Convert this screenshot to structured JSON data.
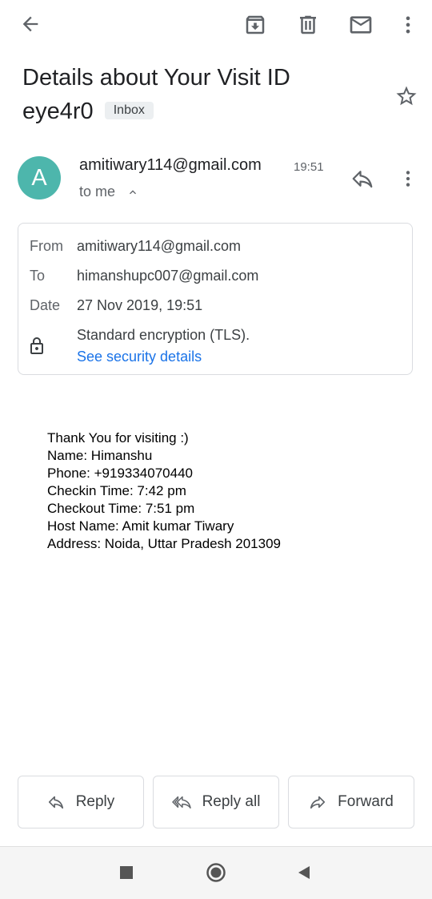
{
  "toolbar": {
    "back_icon": "arrow-left-icon",
    "archive_icon": "archive-icon",
    "delete_icon": "trash-icon",
    "mail_icon": "mail-icon",
    "more_icon": "more-vert-icon"
  },
  "message": {
    "subject": "Details about Your Visit ID eye4r0",
    "label": "Inbox",
    "starred": false
  },
  "sender": {
    "avatar_letter": "A",
    "avatar_color": "#4db6ac",
    "email": "amitiwary114@gmail.com",
    "time": "19:51",
    "to_text": "to me"
  },
  "details": {
    "from_label": "From",
    "from_value": "amitiwary114@gmail.com",
    "to_label": "To",
    "to_value": "himanshupc007@gmail.com",
    "date_label": "Date",
    "date_value": "27 Nov 2019, 19:51",
    "encryption_text": "Standard encryption (TLS).",
    "security_link": "See security details"
  },
  "body": {
    "lines": [
      "Thank You for visiting :)",
      "Name: Himanshu",
      "Phone: +919334070440",
      "Checkin Time: 7:42 pm",
      "Checkout Time: 7:51 pm",
      "Host Name: Amit kumar Tiwary",
      "Address: Noida, Uttar Pradesh 201309"
    ]
  },
  "actions": {
    "reply": "Reply",
    "reply_all": "Reply all",
    "forward": "Forward"
  },
  "colors": {
    "link": "#1a73e8",
    "icon": "#5f6368"
  }
}
